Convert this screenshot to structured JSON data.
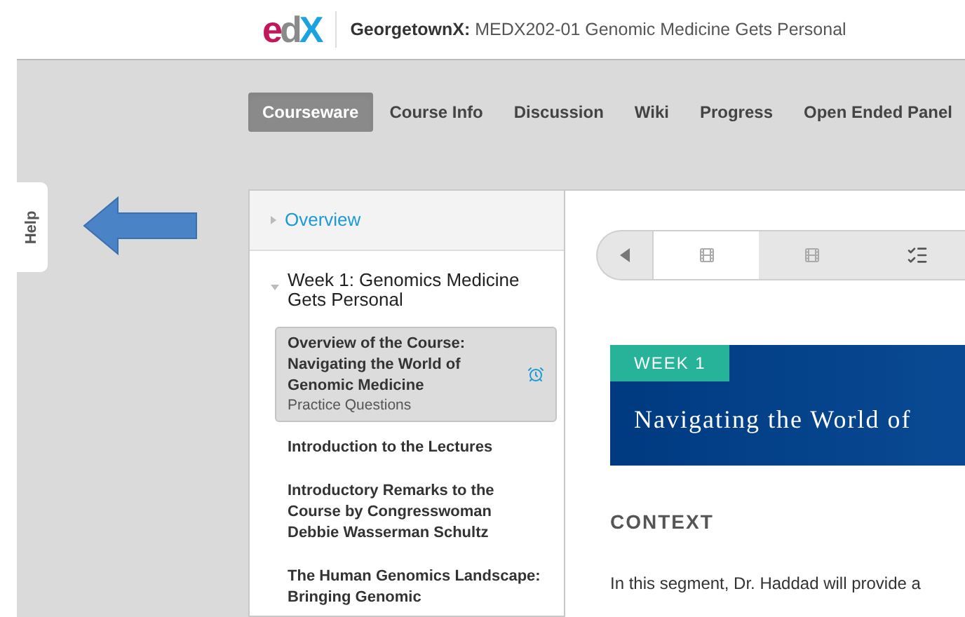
{
  "header": {
    "logo": "edX",
    "org": "GeorgetownX:",
    "course": "MEDX202-01 Genomic Medicine Gets Personal"
  },
  "nav_tabs": [
    {
      "label": "Courseware",
      "selected": true
    },
    {
      "label": "Course Info",
      "selected": false
    },
    {
      "label": "Discussion",
      "selected": false
    },
    {
      "label": "Wiki",
      "selected": false
    },
    {
      "label": "Progress",
      "selected": false
    },
    {
      "label": "Open Ended Panel",
      "selected": false
    }
  ],
  "help_tab": "Help",
  "sidebar": {
    "overview": {
      "label": "Overview",
      "expanded": false
    },
    "week": {
      "label": "Week 1: Genomics Medicine Gets Personal",
      "expanded": true,
      "items": [
        {
          "title": "Overview of the Course: Navigating the World of Genomic Medicine",
          "subtitle": "Practice Questions",
          "selected": true,
          "due": true
        },
        {
          "title": "Introduction to the Lectures",
          "selected": false,
          "due": false
        },
        {
          "title": "Introductory Remarks to the Course by Congresswoman Debbie Wasserman Schultz",
          "selected": false,
          "due": false
        },
        {
          "title": "The Human Genomics Landscape: Bringing Genomic",
          "selected": false,
          "due": false
        }
      ]
    }
  },
  "sequence": {
    "tabs": [
      {
        "kind": "video",
        "selected": true
      },
      {
        "kind": "video",
        "selected": false
      },
      {
        "kind": "problem",
        "selected": false
      }
    ]
  },
  "banner": {
    "badge": "WEEK 1",
    "title": "Navigating the World of"
  },
  "section_heading": "CONTEXT",
  "paragraph": "In this segment, Dr. Haddad will provide a"
}
